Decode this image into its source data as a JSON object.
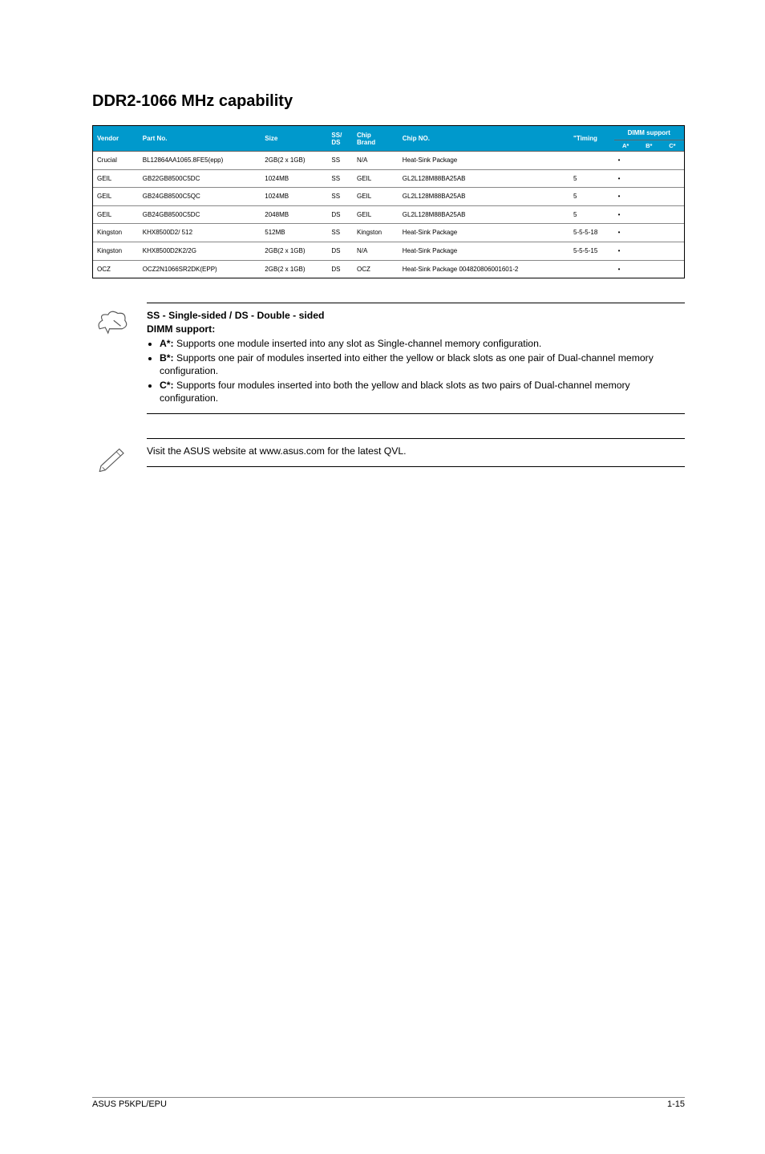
{
  "title": "DDR2-1066 MHz capability",
  "table": {
    "headers": {
      "vendor": "Vendor",
      "partno": "Part No.",
      "size": "Size",
      "ssds": "SS/\nDS",
      "chipbrand": "Chip\nBrand",
      "chipno": "Chip NO.",
      "timing": "\"Timing",
      "dimm": "DIMM support",
      "a": "A*",
      "b": "B*",
      "c": "C*"
    },
    "rows": [
      {
        "vendor": "Crucial",
        "partno": "BL12864AA1065.8FE5(epp)",
        "size": "2GB(2 x 1GB)",
        "ssds": "SS",
        "chipbrand": "N/A",
        "chipno": "Heat-Sink Package",
        "timing": "",
        "a": "•",
        "b": "",
        "c": ""
      },
      {
        "vendor": "GEIL",
        "partno": "GB22GB8500C5DC",
        "size": "1024MB",
        "ssds": "SS",
        "chipbrand": "GEIL",
        "chipno": "GL2L128M88BA25AB",
        "timing": "5",
        "a": "•",
        "b": "",
        "c": ""
      },
      {
        "vendor": "GEIL",
        "partno": "GB24GB8500C5QC",
        "size": "1024MB",
        "ssds": "SS",
        "chipbrand": "GEIL",
        "chipno": "GL2L128M88BA25AB",
        "timing": "5",
        "a": "•",
        "b": "",
        "c": ""
      },
      {
        "vendor": "GEIL",
        "partno": "GB24GB8500C5DC",
        "size": "2048MB",
        "ssds": "DS",
        "chipbrand": "GEIL",
        "chipno": "GL2L128M88BA25AB",
        "timing": "5",
        "a": "•",
        "b": "",
        "c": ""
      },
      {
        "vendor": "Kingston",
        "partno": "KHX8500D2/ 512",
        "size": "512MB",
        "ssds": "SS",
        "chipbrand": "Kingston",
        "chipno": "Heat-Sink Package",
        "timing": "5-5-5-18",
        "a": "•",
        "b": "",
        "c": ""
      },
      {
        "vendor": "Kingston",
        "partno": "KHX8500D2K2/2G",
        "size": "2GB(2 x 1GB)",
        "ssds": "DS",
        "chipbrand": "N/A",
        "chipno": "Heat-Sink Package",
        "timing": "5-5-5-15",
        "a": "•",
        "b": "",
        "c": ""
      },
      {
        "vendor": "OCZ",
        "partno": "OCZ2N1066SR2DK(EPP)",
        "size": "2GB(2 x 1GB)",
        "ssds": "DS",
        "chipbrand": "OCZ",
        "chipno": "Heat-Sink Package 004820806001601-2",
        "timing": "",
        "a": "•",
        "b": "",
        "c": ""
      }
    ]
  },
  "note1": {
    "heading1": "SS - Single-sided / DS - Double - sided",
    "heading2": "DIMM support:",
    "bullets": [
      {
        "label": "A*:",
        "text": " Supports one module inserted into any slot as Single-channel memory configuration."
      },
      {
        "label": "B*:",
        "text": " Supports one pair of modules inserted into either the yellow or black slots as one pair of Dual-channel memory configuration."
      },
      {
        "label": "C*:",
        "text": " Supports four modules inserted into both the yellow and black slots as two pairs of Dual-channel memory configuration."
      }
    ]
  },
  "note2": {
    "text": "Visit the ASUS website at www.asus.com for the latest QVL."
  },
  "footer": {
    "left": "ASUS P5KPL/EPU",
    "right": "1-15"
  }
}
